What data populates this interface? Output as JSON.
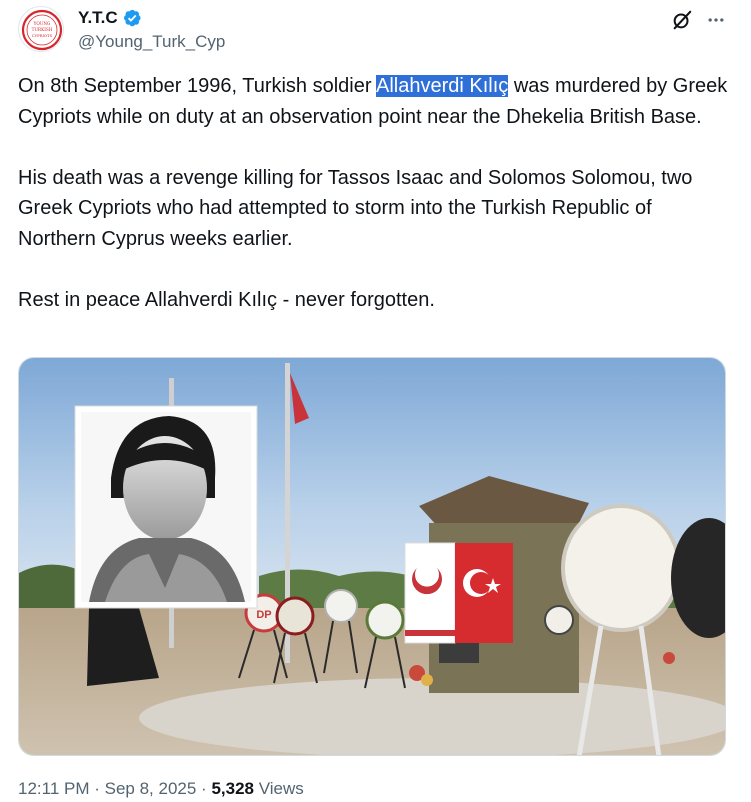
{
  "author": {
    "display_name": "Y.T.C",
    "handle": "@Young_Turk_Cyp",
    "verified": true,
    "verified_color": "#1d9bf0",
    "avatar_text": "YOUNG TURKISH CYPRIOTS",
    "avatar_ring_color": "#d6262b"
  },
  "icons": {
    "grok": "grok-icon",
    "more": "more-icon",
    "verified": "verified-badge-icon"
  },
  "tweet": {
    "p1_before": "On 8th September 1996, Turkish soldier ",
    "p1_highlight": "Allahverdi Kılıç",
    "p1_after": " was murdered by Greek Cypriots while on duty at an observation point near the Dhekelia British Base.",
    "p2": "His death was a revenge killing for Tassos Isaac and Solomos Solomou, two Greek Cypriots who had attempted to storm into the Turkish Republic of Northern Cyprus weeks earlier.",
    "p3": "Rest in peace Allahverdi Kılıç - never forgotten.",
    "highlight_color": "#2f6fd8"
  },
  "media": {
    "wreath_labels": {
      "wreath_dp": "DP"
    }
  },
  "footer": {
    "time": "12:11 PM",
    "separator": " · ",
    "date": "Sep 8, 2025",
    "views_count": "5,328",
    "views_label": "Views"
  }
}
